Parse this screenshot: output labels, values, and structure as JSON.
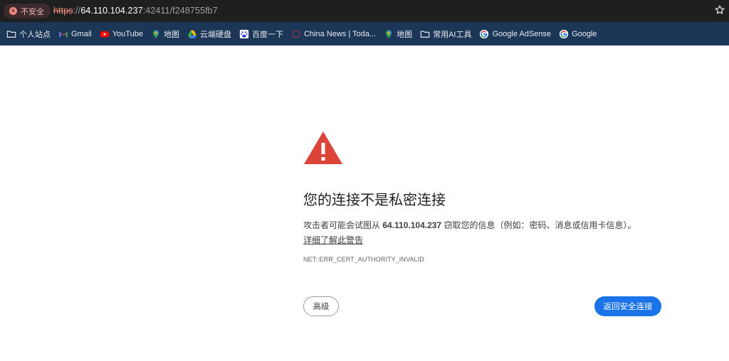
{
  "address_bar": {
    "security_label": "不安全",
    "url_scheme": "https",
    "url_sep": "://",
    "url_host": "64.110.104.237",
    "url_path": ":42411/f248755fb7"
  },
  "bookmarks": [
    {
      "label": "个人站点",
      "icon": "folder-icon"
    },
    {
      "label": "Gmail",
      "icon": "gmail-icon"
    },
    {
      "label": "YouTube",
      "icon": "youtube-icon"
    },
    {
      "label": "地图",
      "icon": "maps-pin-icon"
    },
    {
      "label": "云端硬盘",
      "icon": "drive-icon"
    },
    {
      "label": "百度一下",
      "icon": "baidu-icon"
    },
    {
      "label": "China News | Toda...",
      "icon": "globe-icon"
    },
    {
      "label": "地图",
      "icon": "maps-pin-icon"
    },
    {
      "label": "常用AI工具",
      "icon": "folder-icon"
    },
    {
      "label": "Google AdSense",
      "icon": "google-icon"
    },
    {
      "label": "Google",
      "icon": "google-icon"
    }
  ],
  "interstitial": {
    "heading": "您的连接不是私密连接",
    "desc_before": "攻击者可能会试图从 ",
    "desc_ip": "64.110.104.237",
    "desc_after": " 窃取您的信息（例如：密码、消息或信用卡信息）。",
    "learn_more": "详细了解此警告",
    "error_code": "NET::ERR_CERT_AUTHORITY_INVALID",
    "advanced_button": "高级",
    "back_button": "返回安全连接"
  },
  "colors": {
    "warning_red": "#db4437",
    "primary_blue": "#1a73e8",
    "bookmarks_bar": "#1c3658",
    "address_bar": "#1f1f1f"
  }
}
